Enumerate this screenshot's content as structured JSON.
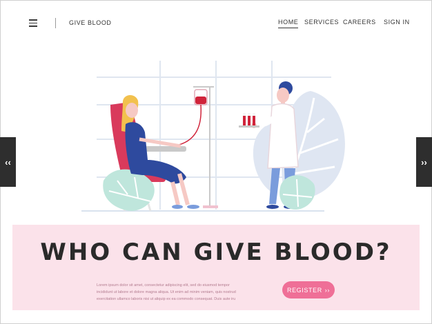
{
  "header": {
    "brand": "GIVE BLOOD",
    "menu_icon": "hamburger-menu-icon",
    "nav": [
      {
        "label": "HOME",
        "active": true
      },
      {
        "label": "SERVICES",
        "active": false
      },
      {
        "label": "CAREERS",
        "active": false
      },
      {
        "label": "SIGN IN",
        "active": false
      }
    ]
  },
  "carousel": {
    "prev_label": "‹‹",
    "next_label": "››"
  },
  "banner": {
    "headline": "WHO CAN GIVE BLOOD?",
    "body": "Lorem ipsum dolor sit amet, consectetur adipiscing elit, sed do eiusmod tempor incididunt ut labore et dolore magna aliqua. Ut enim ad minim veniam, quis nostrud exercitation ullamco laboris nisi ut aliquip ex ea commodo consequat. Duis aute iru",
    "register_label": "REGISTER",
    "register_icon": "››"
  },
  "colors": {
    "banner_bg": "#fbe2ea",
    "accent_pink": "#ef6f97",
    "chair_red": "#d93a5c",
    "dress_blue": "#2e4a9e",
    "blood_red": "#d0233a",
    "leaf_mint": "#b9e3da"
  }
}
